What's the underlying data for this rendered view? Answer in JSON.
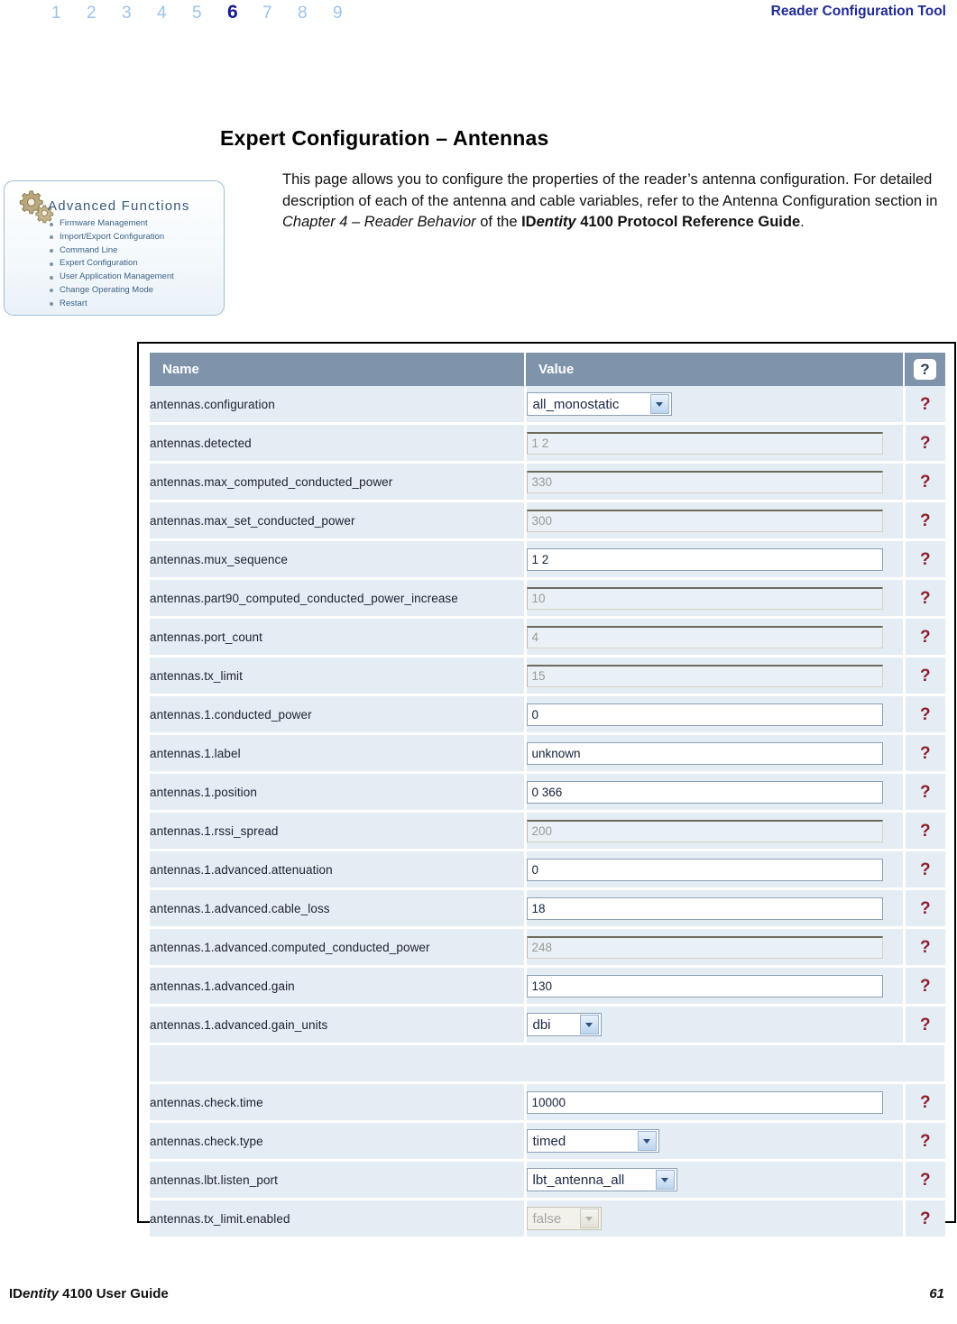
{
  "header": {
    "chapters": [
      "1",
      "2",
      "3",
      "4",
      "5",
      "6",
      "7",
      "8",
      "9"
    ],
    "active_chapter": "6",
    "title": "Reader Configuration Tool"
  },
  "section": {
    "heading": "Expert Configuration – Antennas",
    "intro": {
      "part1": "This page allows you to configure the properties of the reader’s antenna configuration. For detailed description of each of the antenna and cable variables, refer to the Antenna Configuration section in ",
      "italic1": "Chapter 4 – Reader Behavior",
      "part2": " of the ",
      "bold1": "ID",
      "bold_italic1": "entity",
      "bold2": " 4100 Protocol Reference Guide",
      "part3": "."
    }
  },
  "advanced_functions": {
    "title": "Advanced Functions",
    "icon": "gears-icon",
    "items": [
      "Firmware Management",
      "Import/Export Configuration",
      "Command Line",
      "Expert Configuration",
      "User Application Management",
      "Change Operating Mode",
      "Restart"
    ]
  },
  "config_table": {
    "columns": {
      "name": "Name",
      "value": "Value",
      "help": "?"
    },
    "help_glyph": "?",
    "groups": [
      {
        "rows": [
          {
            "name": "antennas.configuration",
            "type": "select",
            "value": "all_monostatic",
            "disabled": false,
            "width_class": "w-config"
          },
          {
            "name": "antennas.detected",
            "type": "text",
            "value": "1 2",
            "disabled": true
          },
          {
            "name": "antennas.max_computed_conducted_power",
            "type": "text",
            "value": "330",
            "disabled": true
          },
          {
            "name": "antennas.max_set_conducted_power",
            "type": "text",
            "value": "300",
            "disabled": true
          },
          {
            "name": "antennas.mux_sequence",
            "type": "text",
            "value": "1 2",
            "disabled": false
          },
          {
            "name": "antennas.part90_computed_conducted_power_increase",
            "type": "text",
            "value": "10",
            "disabled": true
          },
          {
            "name": "antennas.port_count",
            "type": "text",
            "value": "4",
            "disabled": true
          },
          {
            "name": "antennas.tx_limit",
            "type": "text",
            "value": "15",
            "disabled": true
          },
          {
            "name": "antennas.1.conducted_power",
            "type": "text",
            "value": "0",
            "disabled": false
          },
          {
            "name": "antennas.1.label",
            "type": "text",
            "value": "unknown",
            "disabled": false
          },
          {
            "name": "antennas.1.position",
            "type": "text",
            "value": "0 366",
            "disabled": false
          },
          {
            "name": "antennas.1.rssi_spread",
            "type": "text",
            "value": "200",
            "disabled": true
          },
          {
            "name": "antennas.1.advanced.attenuation",
            "type": "text",
            "value": "0",
            "disabled": false
          },
          {
            "name": "antennas.1.advanced.cable_loss",
            "type": "text",
            "value": "18",
            "disabled": false
          },
          {
            "name": "antennas.1.advanced.computed_conducted_power",
            "type": "text",
            "value": "248",
            "disabled": true
          },
          {
            "name": "antennas.1.advanced.gain",
            "type": "text",
            "value": "130",
            "disabled": false
          },
          {
            "name": "antennas.1.advanced.gain_units",
            "type": "select",
            "value": "dbi",
            "disabled": false,
            "width_class": "w-gain"
          }
        ]
      },
      {
        "rows": [
          {
            "name": "antennas.check.time",
            "type": "text",
            "value": "10000",
            "disabled": false
          },
          {
            "name": "antennas.check.type",
            "type": "select",
            "value": "timed",
            "disabled": false,
            "width_class": "w-check"
          },
          {
            "name": "antennas.lbt.listen_port",
            "type": "select",
            "value": "lbt_antenna_all",
            "disabled": false,
            "width_class": "w-lbt"
          },
          {
            "name": "antennas.tx_limit.enabled",
            "type": "select",
            "value": "false",
            "disabled": true,
            "width_class": "w-false"
          }
        ]
      }
    ]
  },
  "footer": {
    "guide_pre": "ID",
    "guide_italic": "entity",
    "guide_post": " 4100 User Guide",
    "page_number": "61"
  }
}
